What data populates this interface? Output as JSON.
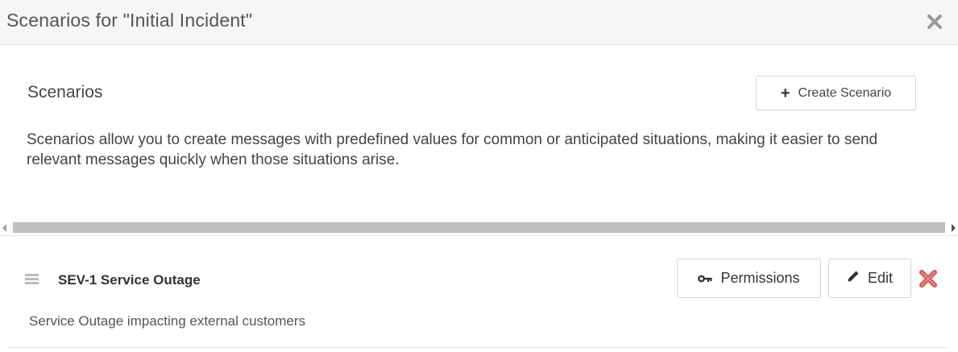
{
  "modal": {
    "title": "Scenarios for \"Initial Incident\"",
    "close_icon": "close-icon"
  },
  "section": {
    "title": "Scenarios",
    "create_button": {
      "icon": "plus-icon",
      "label": "Create Scenario"
    },
    "description": "Scenarios allow you to create messages with predefined values for common or anticipated situations, making it easier to send relevant messages quickly when those situations arise."
  },
  "scenarios": [
    {
      "name": "SEV-1 Service Outage",
      "description": "Service Outage impacting external customers",
      "permissions_button": {
        "icon": "key-icon",
        "label": "Permissions"
      },
      "edit_button": {
        "icon": "pencil-icon",
        "label": "Edit"
      },
      "delete_icon": "delete-icon"
    }
  ],
  "colors": {
    "header_bg": "#f5f6f6",
    "delete_red": "#d9534f",
    "text": "#333333"
  }
}
